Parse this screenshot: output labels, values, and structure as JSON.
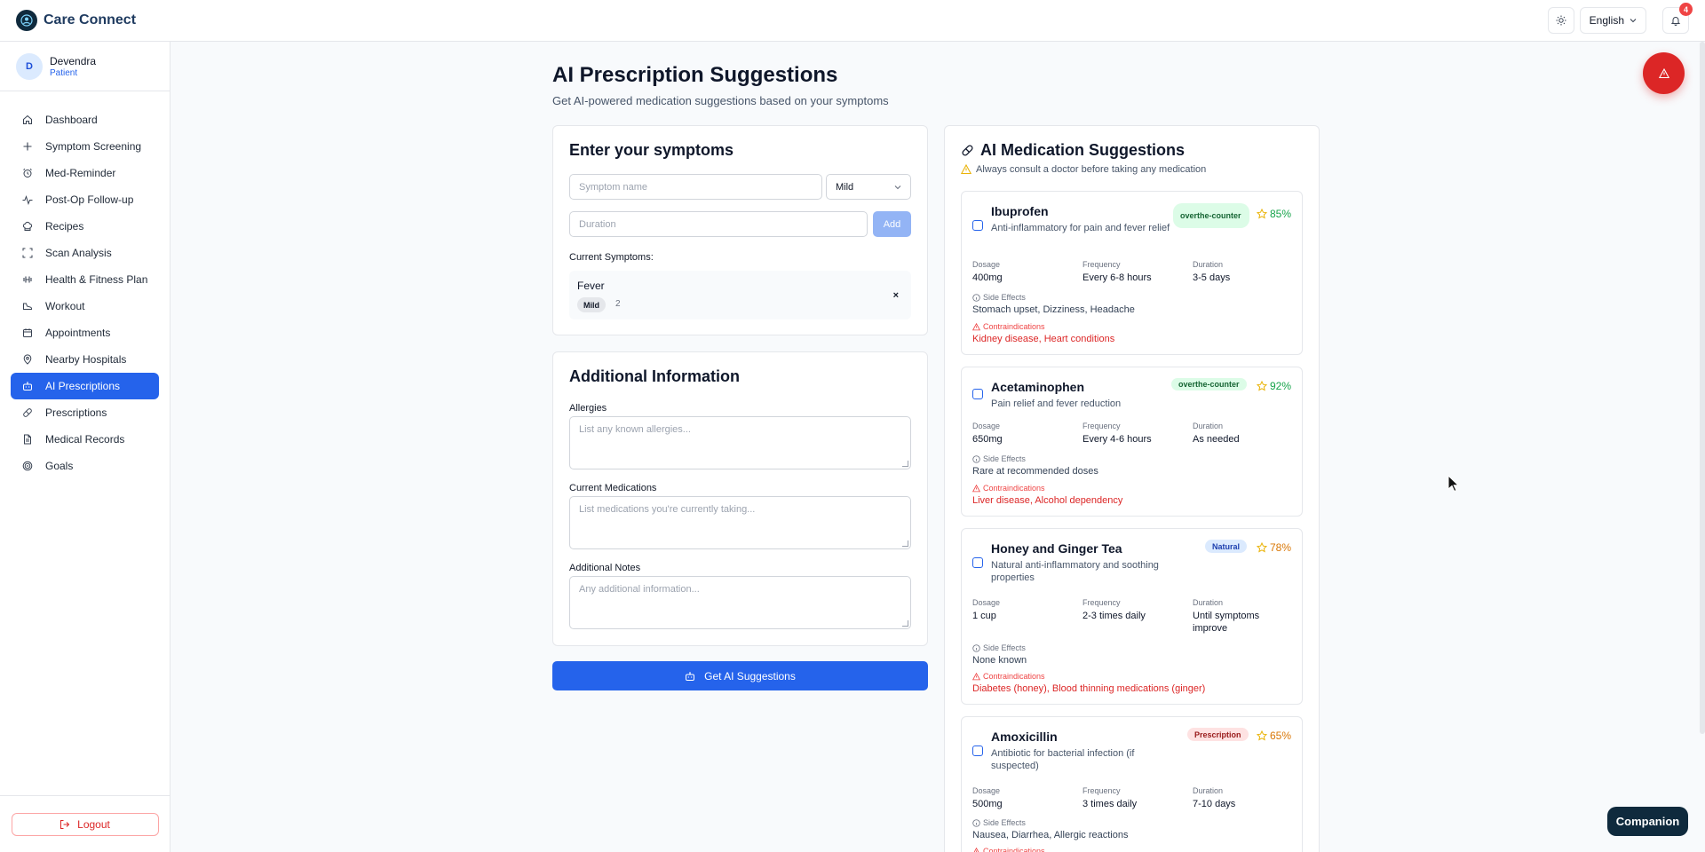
{
  "app": {
    "name": "Care Connect",
    "language": "English",
    "notification_count": "4"
  },
  "user": {
    "initial": "D",
    "name": "Devendra",
    "role": "Patient"
  },
  "sidebar": {
    "items": [
      {
        "label": "Dashboard",
        "icon": "home-icon"
      },
      {
        "label": "Symptom Screening",
        "icon": "plus-icon"
      },
      {
        "label": "Med-Reminder",
        "icon": "alarm-clock-icon"
      },
      {
        "label": "Post-Op Follow-up",
        "icon": "activity-icon"
      },
      {
        "label": "Recipes",
        "icon": "chef-hat-icon"
      },
      {
        "label": "Scan Analysis",
        "icon": "scan-icon"
      },
      {
        "label": "Health & Fitness Plan",
        "icon": "dumbbell-icon"
      },
      {
        "label": "Workout",
        "icon": "shoe-icon"
      },
      {
        "label": "Appointments",
        "icon": "calendar-icon"
      },
      {
        "label": "Nearby Hospitals",
        "icon": "map-pin-icon"
      },
      {
        "label": "AI Prescriptions",
        "icon": "bot-icon",
        "active": true
      },
      {
        "label": "Prescriptions",
        "icon": "pill-icon"
      },
      {
        "label": "Medical Records",
        "icon": "file-icon"
      },
      {
        "label": "Goals",
        "icon": "target-icon"
      }
    ],
    "logout_label": "Logout"
  },
  "page": {
    "title": "AI Prescription Suggestions",
    "subtitle": "Get AI-powered medication suggestions based on your symptoms"
  },
  "symptoms_form": {
    "title": "Enter your symptoms",
    "symptom_placeholder": "Symptom name",
    "severity_value": "Mild",
    "duration_placeholder": "Duration",
    "add_label": "Add",
    "current_label": "Current Symptoms:",
    "current": [
      {
        "name": "Fever",
        "severity": "Mild",
        "duration": "2"
      }
    ]
  },
  "additional_info": {
    "title": "Additional Information",
    "allergies_label": "Allergies",
    "allergies_placeholder": "List any known allergies...",
    "medications_label": "Current Medications",
    "medications_placeholder": "List medications you're currently taking...",
    "notes_label": "Additional Notes",
    "notes_placeholder": "Any additional information..."
  },
  "get_button_label": "Get AI Suggestions",
  "suggestions": {
    "title": "AI Medication Suggestions",
    "warning": "Always consult a doctor before taking any medication",
    "dosage_label": "Dosage",
    "frequency_label": "Frequency",
    "duration_label": "Duration",
    "side_effects_label": "Side Effects",
    "contraindications_label": "Contraindications",
    "items": [
      {
        "name": "Ibuprofen",
        "description": "Anti-inflammatory for pain and fever relief",
        "tag": "overthe-counter",
        "score": "85%",
        "dosage": "400mg",
        "frequency": "Every 6-8 hours",
        "duration": "3-5 days",
        "side_effects": "Stomach upset, Dizziness, Headache",
        "contraindications": "Kidney disease, Heart conditions"
      },
      {
        "name": "Acetaminophen",
        "description": "Pain relief and fever reduction",
        "tag": "overthe-counter",
        "score": "92%",
        "dosage": "650mg",
        "frequency": "Every 4-6 hours",
        "duration": "As needed",
        "side_effects": "Rare at recommended doses",
        "contraindications": "Liver disease, Alcohol dependency"
      },
      {
        "name": "Honey and Ginger Tea",
        "description": "Natural anti-inflammatory and soothing properties",
        "tag": "Natural",
        "score": "78%",
        "dosage": "1 cup",
        "frequency": "2-3 times daily",
        "duration": "Until symptoms improve",
        "side_effects": "None known",
        "contraindications": "Diabetes (honey), Blood thinning medications (ginger)"
      },
      {
        "name": "Amoxicillin",
        "description": "Antibiotic for bacterial infection (if suspected)",
        "tag": "Prescription",
        "score": "65%",
        "dosage": "500mg",
        "frequency": "3 times daily",
        "duration": "7-10 days",
        "side_effects": "Nausea, Diarrhea, Allergic reactions",
        "contraindications": ""
      }
    ]
  },
  "companion_label": "Companion",
  "colors": {
    "primary": "#2563eb",
    "danger": "#dc2626",
    "brand_dark": "#0f2a3d"
  }
}
